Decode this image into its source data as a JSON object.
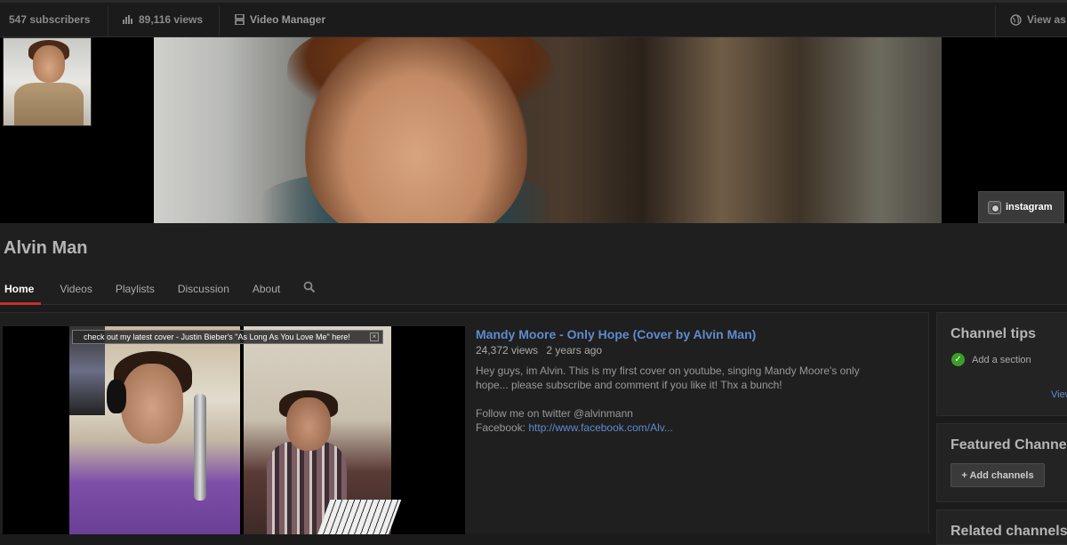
{
  "topbar": {
    "subscribers": "547 subscribers",
    "views": "89,116 views",
    "video_manager": "Video Manager",
    "view_as": "View as"
  },
  "banner": {
    "instagram_label": "instagram"
  },
  "channel": {
    "name": "Alvin Man",
    "tabs": [
      "Home",
      "Videos",
      "Playlists",
      "Discussion",
      "About"
    ]
  },
  "featured_video": {
    "annotation": "check out my latest cover - Justin Bieber's \"As Long As You Love Me\" here!",
    "annotation_close": "×",
    "title": "Mandy Moore - Only Hope (Cover by Alvin Man)",
    "views": "24,372 views",
    "age": "2 years ago",
    "description_line1": "Hey guys, im Alvin. This is my first cover on youtube, singing Mandy Moore's only",
    "description_line2": "hope... please subscribe and comment if you like it! Thx a bunch!",
    "description_line3": "Follow me on twitter @alvinmann",
    "facebook_prefix": "Facebook: ",
    "facebook_link": "http://www.facebook.com/Alv..."
  },
  "sidebar": {
    "channel_tips_title": "Channel tips",
    "add_section": "Add a section",
    "view_link": "View",
    "featured_channels_title": "Featured Channels",
    "add_channels_button": "+ Add channels",
    "related_channels_title": "Related channels"
  },
  "colors": {
    "accent_red": "#c4302b",
    "link_blue": "#5f8bcf",
    "check_green": "#3a9e2a",
    "background": "#1b1b1b"
  }
}
